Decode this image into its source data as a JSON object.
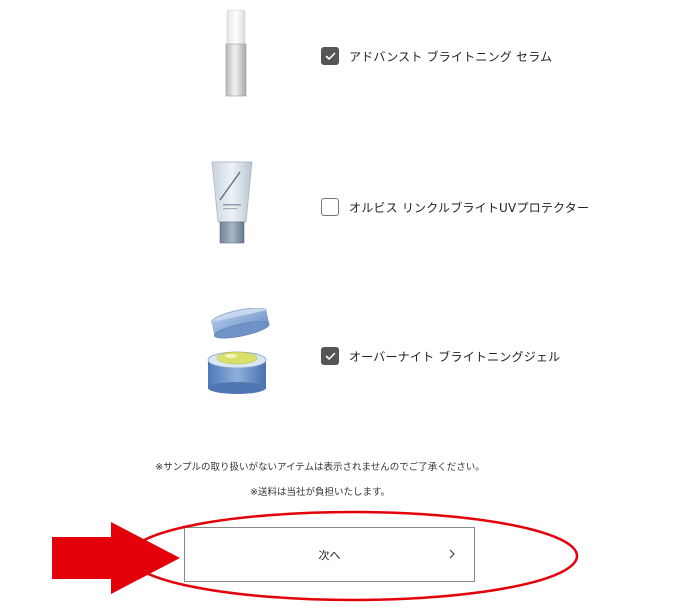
{
  "products": [
    {
      "label": "アドバンスト ブライトニング セラム",
      "checked": true,
      "image_icon": "serum-bottle-image"
    },
    {
      "label": "オルビス リンクルブライトUVプロテクター",
      "checked": false,
      "image_icon": "uv-tube-image"
    },
    {
      "label": "オーバーナイト ブライトニングジェル",
      "checked": true,
      "image_icon": "gel-jar-image"
    }
  ],
  "notes": {
    "line1": "※サンプルの取り扱いがないアイテムは表示されませんのでご了承ください。",
    "line2": "※送料は当社が負担いたします。"
  },
  "next_button": {
    "label": "次へ",
    "icon": "chevron-right-icon"
  },
  "annotation": {
    "arrow_color": "#e3000b",
    "ellipse_color": "#e3000b"
  }
}
